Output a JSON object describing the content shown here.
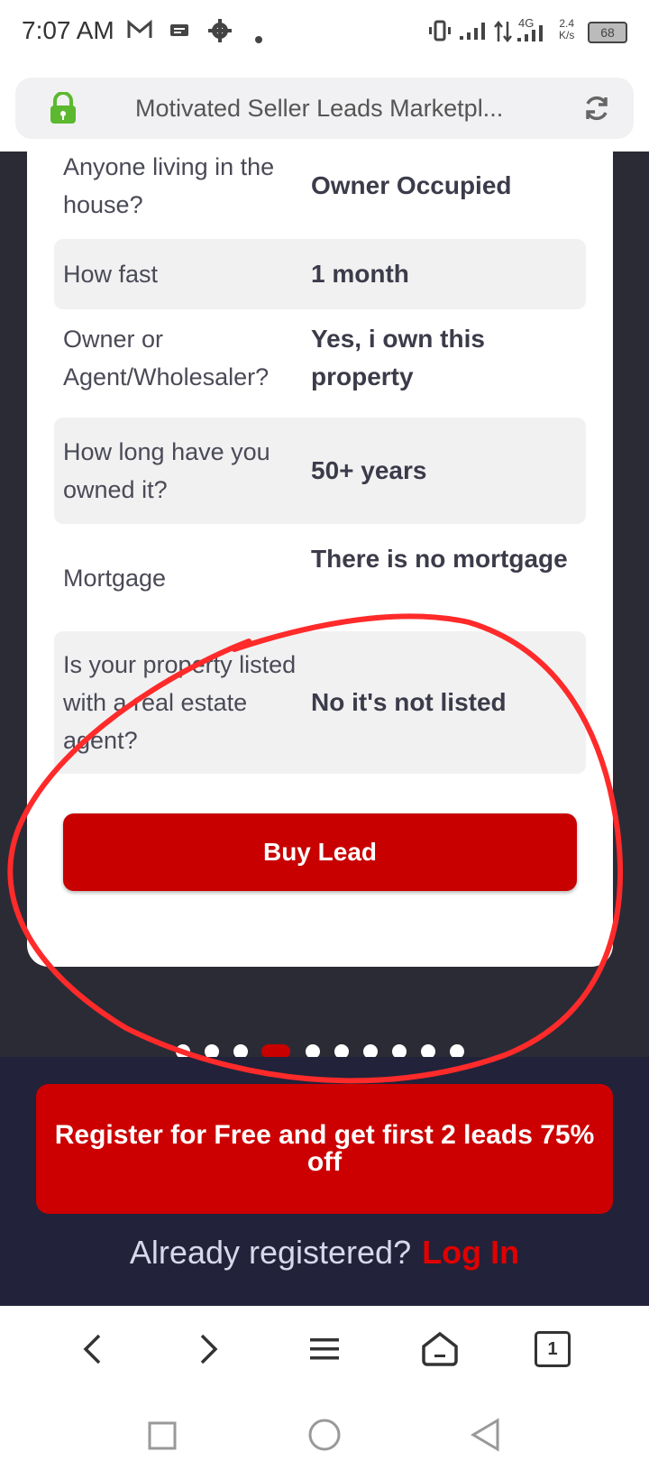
{
  "status_bar": {
    "time": "7:07 AM",
    "network": "4G",
    "speed": "2.4",
    "speed_unit": "K/s",
    "battery": "68"
  },
  "browser": {
    "page_title": "Motivated Seller Leads Marketpl..."
  },
  "lead_details": [
    {
      "question": "Anyone living in the house?",
      "answer": "Owner Occupied"
    },
    {
      "question": "How fast",
      "answer": "1 month"
    },
    {
      "question": "Owner or Agent/Wholesaler?",
      "answer": "Yes, i own this property"
    },
    {
      "question": "How long have you owned it?",
      "answer": "50+ years"
    },
    {
      "question": "Mortgage",
      "answer": "There is no mortgage"
    },
    {
      "question": "Is your property listed with a real estate agent?",
      "answer": "No it's not listed"
    }
  ],
  "buy_button_label": "Buy Lead",
  "carousel": {
    "total": 10,
    "active_index": 3
  },
  "register_label": "Register for Free and get first 2 leads 75% off",
  "login_prompt": {
    "text": "Already registered?",
    "link": "Log In"
  },
  "browser_nav": {
    "tab_count": "1"
  },
  "colors": {
    "accent": "#c80000",
    "background": "#2b2b36",
    "annotation": "#ff2a2a"
  }
}
